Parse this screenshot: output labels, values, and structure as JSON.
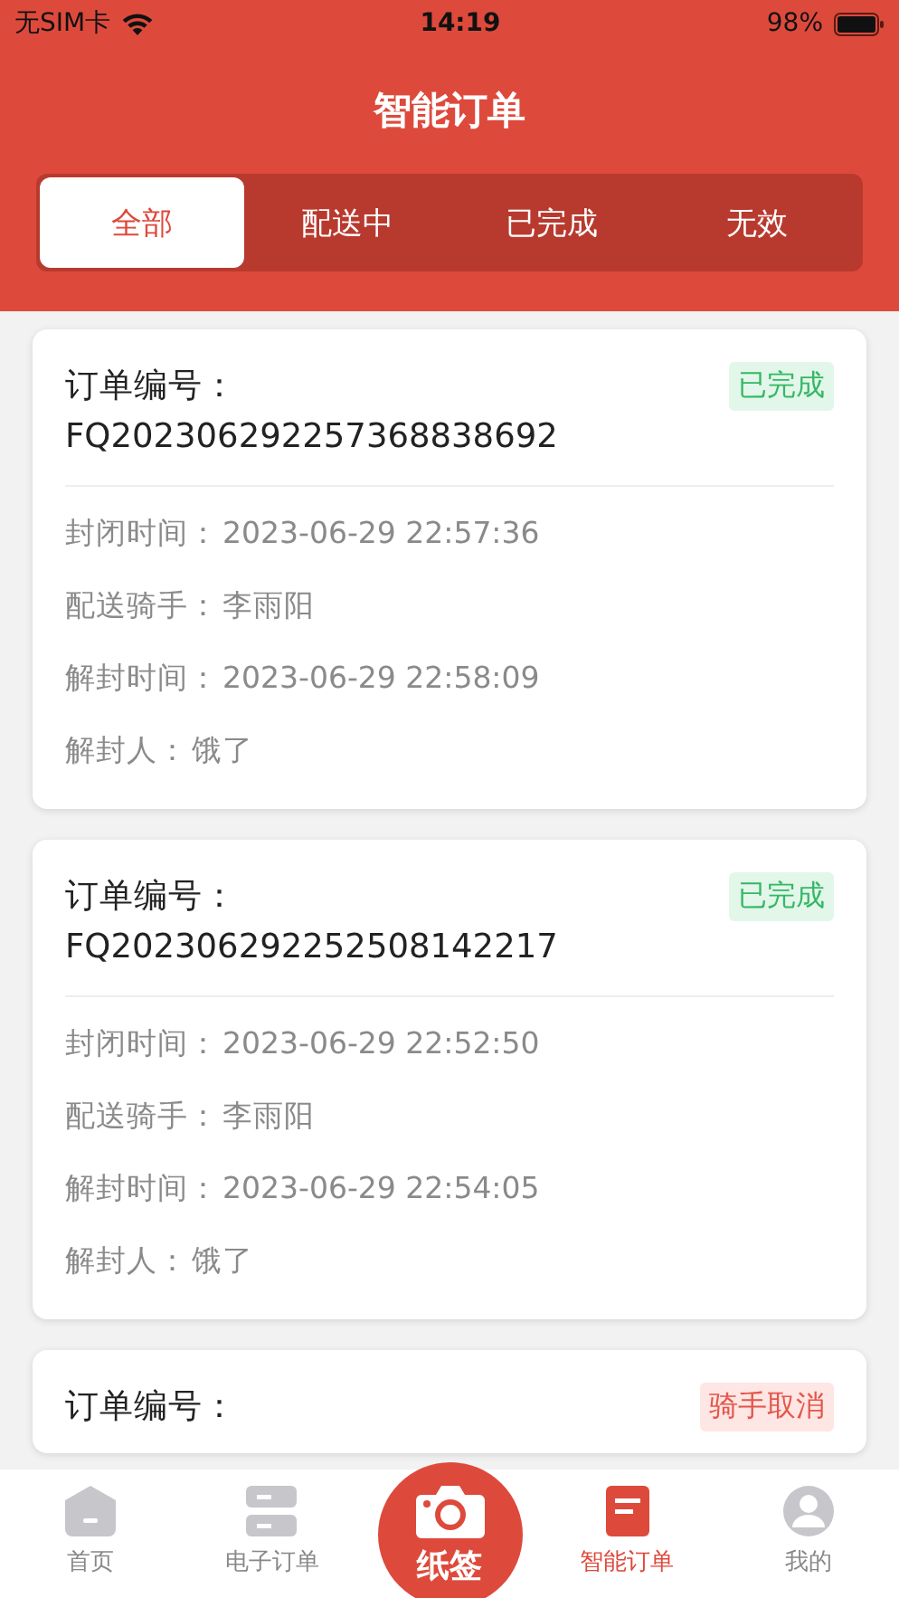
{
  "status_bar": {
    "carrier": "无SIM卡",
    "time": "14:19",
    "battery": "98%"
  },
  "header": {
    "title": "智能订单"
  },
  "tabs": [
    {
      "label": "全部",
      "selected": true
    },
    {
      "label": "配送中",
      "selected": false
    },
    {
      "label": "已完成",
      "selected": false
    },
    {
      "label": "无效",
      "selected": false
    }
  ],
  "orders": [
    {
      "number_label": "订单编号：",
      "number": "FQ202306292257368838692",
      "status": "已完成",
      "kind": "done",
      "fields": [
        {
          "label": "封闭时间：",
          "value": "2023-06-29 22:57:36"
        },
        {
          "label": "配送骑手：",
          "value": "李雨阳"
        },
        {
          "label": "解封时间：",
          "value": "2023-06-29 22:58:09"
        },
        {
          "label": "解封人：",
          "value": "饿了"
        }
      ]
    },
    {
      "number_label": "订单编号：",
      "number": "FQ202306292252508142217",
      "status": "已完成",
      "kind": "done",
      "fields": [
        {
          "label": "封闭时间：",
          "value": "2023-06-29 22:52:50"
        },
        {
          "label": "配送骑手：",
          "value": "李雨阳"
        },
        {
          "label": "解封时间：",
          "value": "2023-06-29 22:54:05"
        },
        {
          "label": "解封人：",
          "value": "饿了"
        }
      ]
    },
    {
      "number_label": "订单编号：",
      "status": "骑手取消",
      "kind": "cancelled"
    }
  ],
  "tab_bar": [
    {
      "label": "首页",
      "kind": "home",
      "selected": false
    },
    {
      "label": "电子订单",
      "kind": "list",
      "selected": false
    },
    {
      "label": "纸签",
      "kind": "camera"
    },
    {
      "label": "智能订单",
      "kind": "smart",
      "selected": true
    },
    {
      "label": "我的",
      "kind": "user",
      "selected": false
    }
  ]
}
